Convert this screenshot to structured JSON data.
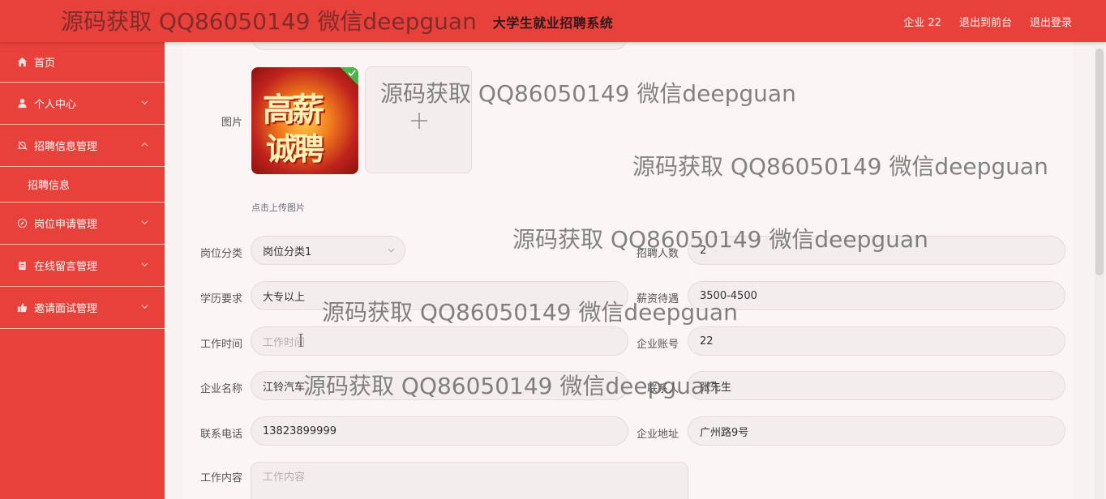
{
  "header": {
    "title": "大学生就业招聘系统",
    "nav": [
      "企业 22",
      "退出到前台",
      "退出登录"
    ]
  },
  "sidebar": {
    "items": [
      {
        "label": "首页",
        "icon": "home-icon"
      },
      {
        "label": "个人中心",
        "icon": "user-icon"
      },
      {
        "label": "招聘信息管理",
        "icon": "bell-off-icon"
      },
      {
        "label": "招聘信息",
        "icon": ""
      },
      {
        "label": "岗位申请管理",
        "icon": "compass-icon"
      },
      {
        "label": "在线留言管理",
        "icon": "clipboard-icon"
      },
      {
        "label": "邀请面试管理",
        "icon": "thumb-up-icon"
      }
    ]
  },
  "form": {
    "image_label": "图片",
    "image_text_1": "高薪",
    "image_text_2": "诚聘",
    "upload_hint": "点击上传图片",
    "category_label": "岗位分类",
    "category_value": "岗位分类1",
    "headcount_label": "招聘人数",
    "headcount_value": "2",
    "education_label": "学历要求",
    "education_value": "大专以上",
    "salary_label": "薪资待遇",
    "salary_value": "3500-4500",
    "worktime_label": "工作时间",
    "worktime_placeholder": "工作时间",
    "account_label": "企业账号",
    "account_value": "22",
    "company_label": "企业名称",
    "company_value": "江铃汽车",
    "contact_label": "联系人",
    "contact_value": "张先生",
    "phone_label": "联系电话",
    "phone_value": "13823899999",
    "address_label": "企业地址",
    "address_value": "广州路9号",
    "content_label": "工作内容",
    "content_placeholder": "工作内容"
  },
  "watermark": "源码获取 QQ86050149 微信deepguan",
  "colors": {
    "brand": "#e8403b",
    "panel": "#fbf6f5",
    "field": "#f3eeed"
  }
}
